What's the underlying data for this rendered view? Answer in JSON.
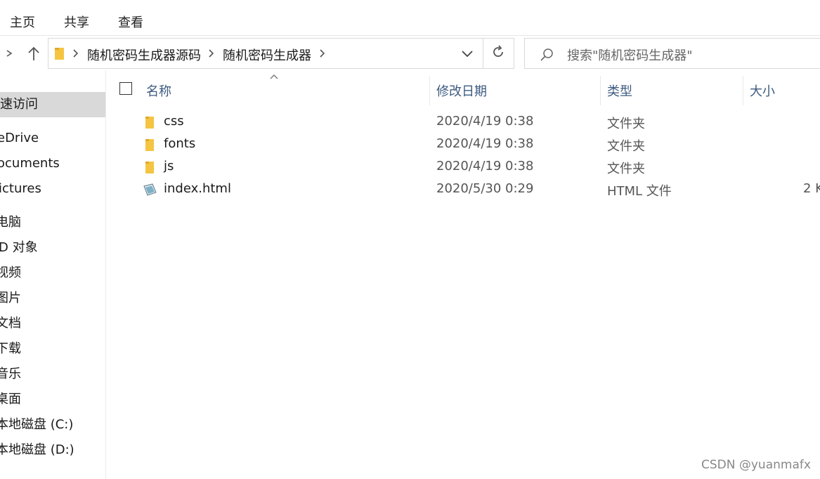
{
  "ribbon": {
    "tabs": [
      "主页",
      "共享",
      "查看"
    ]
  },
  "address_bar": {
    "crumbs": [
      "随机密码生成器源码",
      "随机密码生成器"
    ],
    "search_placeholder": "搜索\"随机密码生成器\""
  },
  "nav_pane": {
    "items": [
      {
        "label": "速访问",
        "selected": true
      },
      {
        "label": "eDrive"
      },
      {
        "label": "ocuments"
      },
      {
        "label": "ictures"
      },
      {
        "label": "电脑"
      },
      {
        "label": "D 对象"
      },
      {
        "label": "视频"
      },
      {
        "label": "图片"
      },
      {
        "label": "文档"
      },
      {
        "label": "下载"
      },
      {
        "label": "音乐"
      },
      {
        "label": "桌面"
      },
      {
        "label": "本地磁盘 (C:)"
      },
      {
        "label": "本地磁盘 (D:)"
      }
    ]
  },
  "columns": {
    "name": "名称",
    "date": "修改日期",
    "type": "类型",
    "size": "大小"
  },
  "files": [
    {
      "name": "css",
      "date": "2020/4/19 0:38",
      "type": "文件夹",
      "size": "",
      "icon": "folder-icon"
    },
    {
      "name": "fonts",
      "date": "2020/4/19 0:38",
      "type": "文件夹",
      "size": "",
      "icon": "folder-icon"
    },
    {
      "name": "js",
      "date": "2020/4/19 0:38",
      "type": "文件夹",
      "size": "",
      "icon": "folder-icon"
    },
    {
      "name": "index.html",
      "date": "2020/5/30 0:29",
      "type": "HTML 文件",
      "size": "2 K",
      "icon": "html-file-icon"
    }
  ],
  "watermark": "CSDN @yuanmafx",
  "colors": {
    "folder": "#f5c542",
    "header_text": "#3d5a80",
    "selected_bg": "#d9d9d9"
  }
}
